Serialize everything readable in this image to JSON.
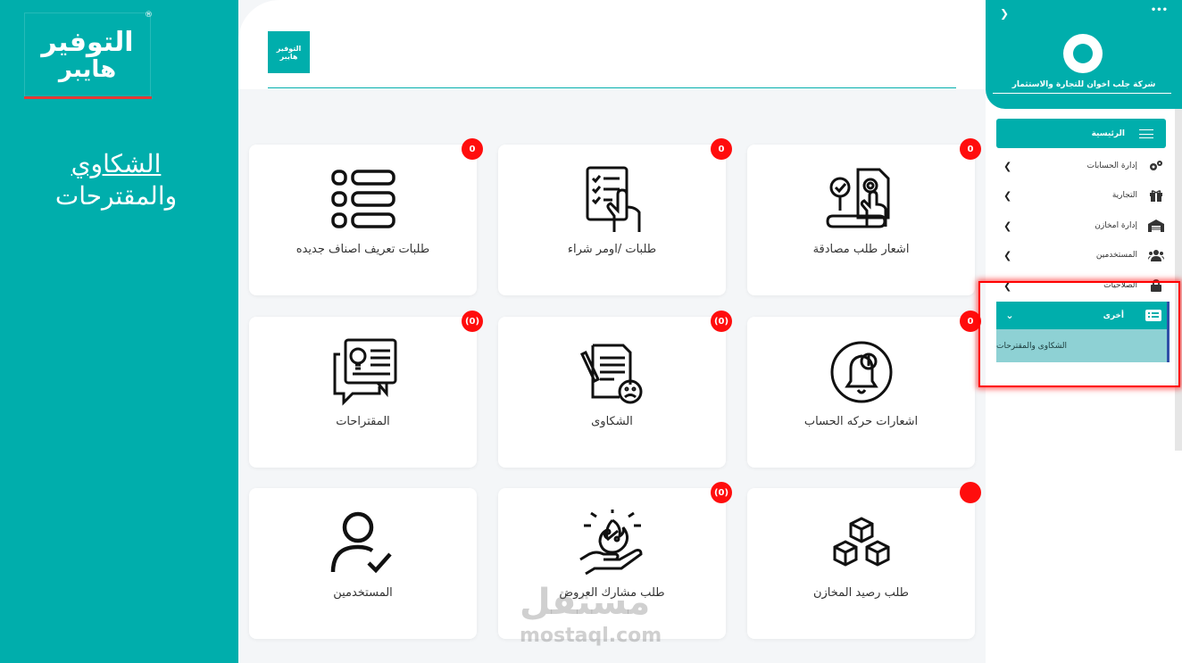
{
  "brand": {
    "logo_line1": "التوفير",
    "logo_line2": "هايبر",
    "registered": "®"
  },
  "page_title": {
    "line1": "الشكاوي",
    "line2": "والمقترحات"
  },
  "header": {
    "logo_line1": "التوفير",
    "logo_line2": "هايبر"
  },
  "cards": [
    {
      "label": "طلبات تعريف اصناف جديده",
      "badge": "0",
      "icon": "list-icon"
    },
    {
      "label": "طلبات /اومر شراء",
      "badge": "0",
      "icon": "checklist-touch-icon"
    },
    {
      "label": "اشعار طلب مصادقة",
      "badge": "0",
      "icon": "document-approval-icon"
    },
    {
      "label": "المقتراحات",
      "badge": "(0)",
      "icon": "suggestion-bubble-icon"
    },
    {
      "label": "الشكاوى",
      "badge": "(0)",
      "icon": "complaint-document-icon"
    },
    {
      "label": "اشعارات حركه الحساب",
      "badge": "0",
      "icon": "bell-notification-icon"
    },
    {
      "label": "المستخدمين",
      "badge": "",
      "icon": "user-check-icon"
    },
    {
      "label": "طلب مشارك العروض",
      "badge": "(0)",
      "icon": "offer-hand-icon"
    },
    {
      "label": "طلب رصيد المخازن",
      "badge": "",
      "icon": "boxes-icon"
    }
  ],
  "sidebar": {
    "company": "شركة جلب اخوان للتجارة والاستثمار",
    "home": "الرئيسية",
    "items": [
      {
        "label": "إدارة الحسابات",
        "icon": "gears-icon"
      },
      {
        "label": "التجارية",
        "icon": "gift-icon"
      },
      {
        "label": "إدارة امخازن",
        "icon": "warehouse-icon"
      },
      {
        "label": "المستخدمين",
        "icon": "users-icon"
      },
      {
        "label": "الصلاحيات",
        "icon": "lock-icon"
      }
    ],
    "other": "أخرى",
    "sub_item": "الشكاوى والمقترحات"
  },
  "watermark": {
    "text": "مستقل",
    "url": "mostaql.com"
  },
  "colors": {
    "accent": "#00aeac",
    "badge": "#ff0d0d",
    "highlight": "#ff0000"
  }
}
